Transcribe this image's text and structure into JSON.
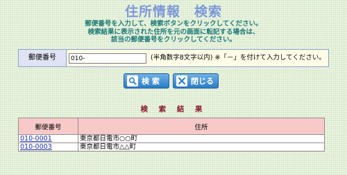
{
  "page": {
    "title": "住所情報　検索",
    "instructions": [
      "郵便番号を入力して、検索ボタンをクリックしてください。",
      "検索結果に表示された住所を元の画面に転記する場合は、",
      "該当の郵便番号をクリックしてください。"
    ]
  },
  "search_form": {
    "label": "郵便番号",
    "input_value": "010-",
    "hint": "(半角数字8文字以内) ※「－」を付けて入力してください。"
  },
  "buttons": {
    "search_label": "検 索",
    "close_label": "閉じる"
  },
  "results": {
    "heading": "検 索 結 果",
    "columns": [
      "郵便番号",
      "住所"
    ],
    "rows": [
      {
        "code": "010-0001",
        "address": "東京都日電市○○町"
      },
      {
        "code": "010-0003",
        "address": "東京都日電市△△町"
      }
    ]
  },
  "colors": {
    "title": "#7d98d8",
    "instructions": "#1c7a77",
    "results_heading": "#8a1b2b",
    "table_header": "#f7c9c9",
    "button": "#2b7cc6"
  }
}
